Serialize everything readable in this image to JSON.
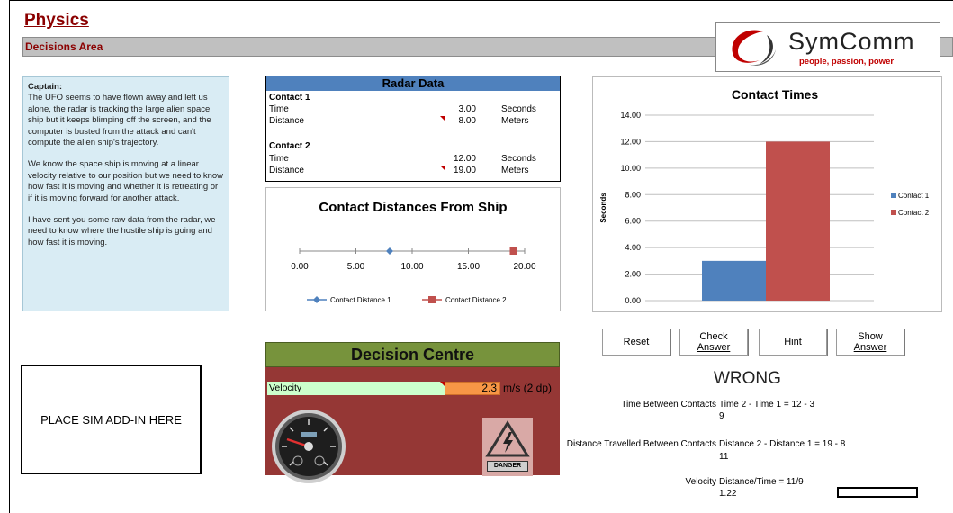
{
  "header": {
    "title": "Physics",
    "section": "Decisions Area",
    "logo_brand": "SymComm",
    "logo_tagline": "people, passion, power"
  },
  "captain": {
    "heading": "Captain:",
    "paragraphs": [
      "The UFO seems to have flown away and left us alone, the radar is tracking the large alien space ship but it keeps blimping off the screen, and the computer is busted from the attack and can't compute the alien ship's trajectory.",
      "We know the space ship is moving at a linear velocity relative to our position but we need to know how fast it is moving and whether it is retreating or if it is moving forward for another attack.",
      "I have sent you some raw data from the radar, we need to know where the hostile ship is going and how fast it is moving."
    ]
  },
  "radar": {
    "title": "Radar Data",
    "contact1": {
      "label": "Contact 1",
      "time_label": "Time",
      "time": "3.00",
      "time_unit": "Seconds",
      "dist_label": "Distance",
      "dist": "8.00",
      "dist_unit": "Meters"
    },
    "contact2": {
      "label": "Contact 2",
      "time_label": "Time",
      "time": "12.00",
      "time_unit": "Seconds",
      "dist_label": "Distance",
      "dist": "19.00",
      "dist_unit": "Meters"
    }
  },
  "chart_data": [
    {
      "type": "scatter",
      "title": "Contact Distances From Ship",
      "x_ticks": [
        "0.00",
        "5.00",
        "10.00",
        "15.00",
        "20.00"
      ],
      "xlim": [
        0,
        20
      ],
      "series": [
        {
          "name": "Contact Distance 1",
          "color": "#4f81bd",
          "marker": "diamond",
          "points": [
            [
              8,
              0
            ]
          ]
        },
        {
          "name": "Contact Distance 2",
          "color": "#c0504d",
          "marker": "square",
          "points": [
            [
              19,
              0
            ]
          ]
        }
      ],
      "legend": "bottom"
    },
    {
      "type": "bar",
      "title": "Contact Times",
      "ylabel": "Seconds",
      "ylim": [
        0,
        14
      ],
      "y_ticks": [
        "0.00",
        "2.00",
        "4.00",
        "6.00",
        "8.00",
        "10.00",
        "12.00",
        "14.00"
      ],
      "grid": true,
      "series": [
        {
          "name": "Contact 1",
          "color": "#4f81bd",
          "value": 3
        },
        {
          "name": "Contact 2",
          "color": "#c0504d",
          "value": 12
        }
      ],
      "legend": "right"
    }
  ],
  "decision": {
    "title": "Decision Centre",
    "velocity_label": "Velocity",
    "velocity_value": "2.3",
    "velocity_unit": "m/s (2 dp)",
    "danger_label": "DANGER"
  },
  "buttons": {
    "reset": "Reset",
    "check_line1": "Check",
    "check_line2": "Answer",
    "hint": "Hint",
    "show_line1": "Show",
    "show_line2": "Answer"
  },
  "result": {
    "status": "WRONG",
    "rows": [
      {
        "key": "Time Between Contacts",
        "line1": "Time 2 - Time 1 = 12 - 3",
        "line2": "9"
      },
      {
        "key": "Distance Travelled Between Contacts",
        "line1": "Distance 2 - Distance 1 = 19 - 8",
        "line2": "11"
      },
      {
        "key": "Velocity",
        "line1": "Distance/Time = 11/9",
        "line2": "1.22"
      }
    ]
  },
  "sim_placeholder": "PLACE SIM ADD-IN HERE"
}
